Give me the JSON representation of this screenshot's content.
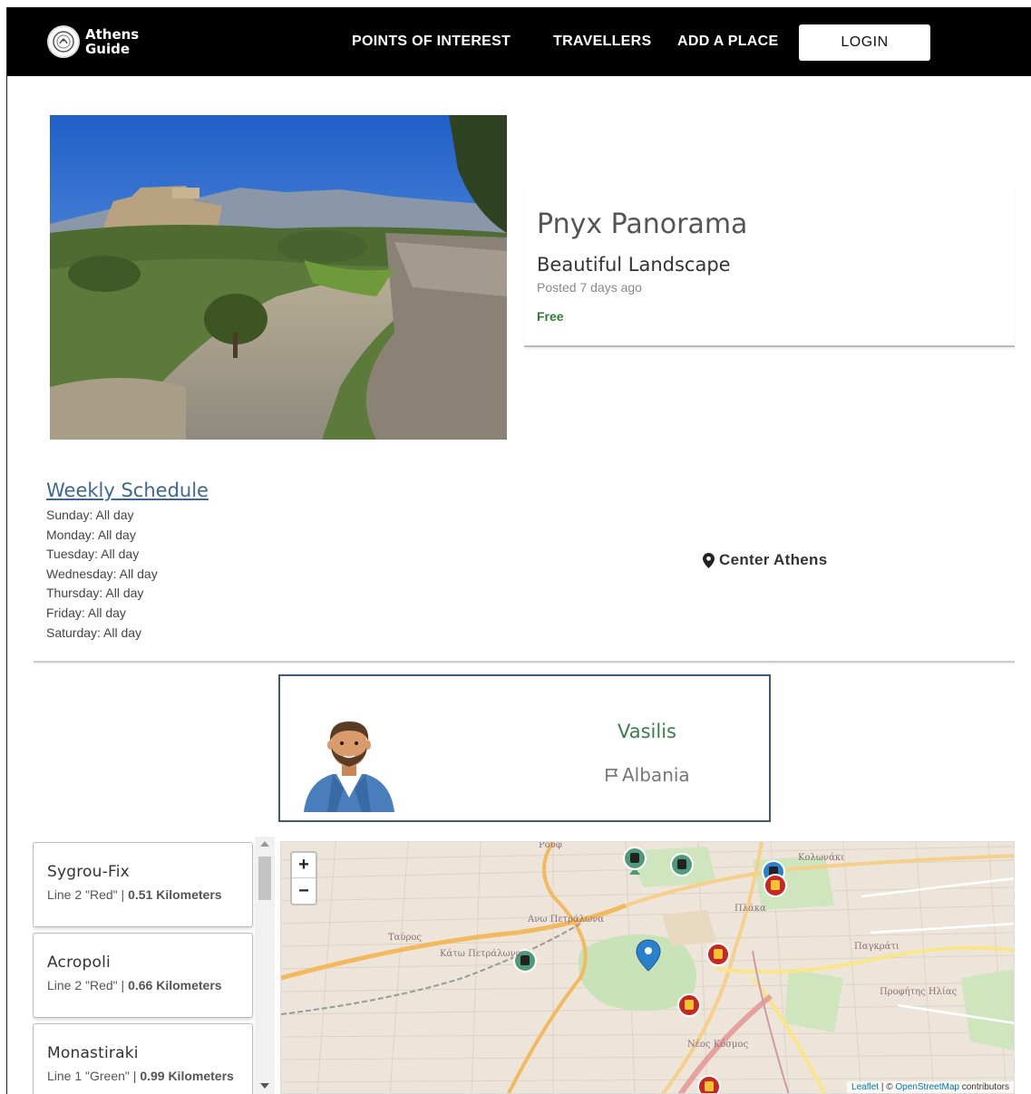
{
  "header": {
    "logo_line1": "Athens",
    "logo_line2": "Guide",
    "nav": [
      "POINTS OF INTEREST",
      "TRAVELLERS",
      "ADD A PLACE"
    ],
    "login_label": "LOGIN"
  },
  "place": {
    "title": "Pnyx Panorama",
    "subtitle": "Beautiful Landscape",
    "posted": "Posted 7 days ago",
    "price": "Free"
  },
  "schedule": {
    "title": "Weekly Schedule",
    "days": [
      "Sunday: All day",
      "Monday: All day",
      "Tuesday: All day",
      "Wednesday: All day",
      "Thursday: All day",
      "Friday: All day",
      "Saturday: All day"
    ]
  },
  "location": "Center Athens",
  "traveller": {
    "name": "Vasilis",
    "country": "Albania"
  },
  "stations": [
    {
      "name": "Sygrou-Fix",
      "line": "Line 2 \"Red\" | ",
      "distance": "0.51 Kilometers"
    },
    {
      "name": "Acropoli",
      "line": "Line 2 \"Red\" | ",
      "distance": "0.66 Kilometers"
    },
    {
      "name": "Monastiraki",
      "line": "Line 1 \"Green\" | ",
      "distance": "0.99 Kilometers"
    }
  ],
  "map": {
    "zoom_in": "+",
    "zoom_out": "−",
    "attribution_leaflet": "Leaflet",
    "attribution_sep": " | © ",
    "attribution_osm": "OpenStreetMap",
    "attribution_tail": " contributors",
    "labels": [
      "Ρουφ",
      "Κολωνάκι",
      "Ταύρος",
      "Ανω Πετράλωνα",
      "Κάτω Πετράλωνα",
      "Πλάκα",
      "Παγκράτι",
      "Νέος Κόσμος",
      "Προφήτης Ηλίας"
    ]
  },
  "colors": {
    "header_bg": "#000000",
    "accent_green": "#3a7d4a",
    "link_blue": "#3f6791",
    "metro_red": "#c62828",
    "metro_green": "#4f9a7a",
    "pin_blue": "#2a81cb"
  }
}
